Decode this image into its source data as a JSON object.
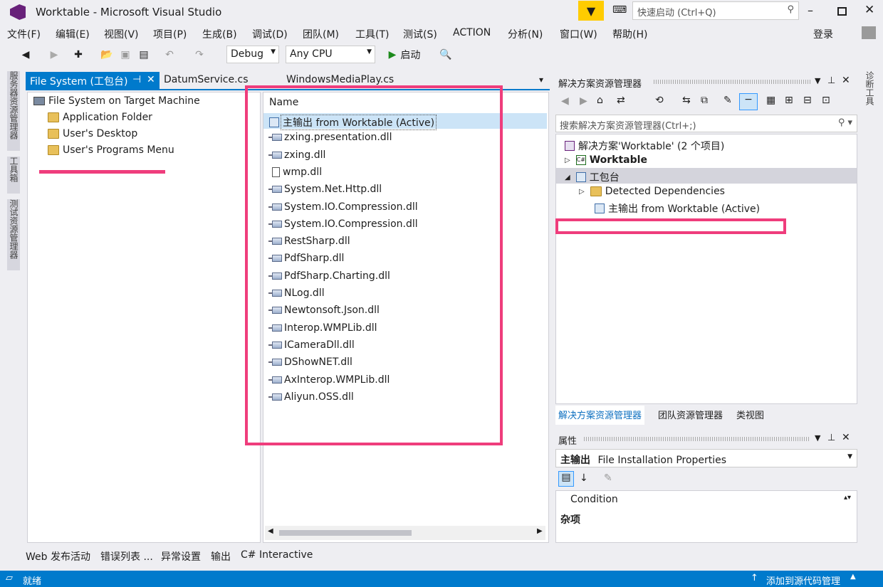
{
  "title": {
    "text": "Worktable - Microsoft Visual Studio",
    "quick_launch_placeholder": "快速启动 (Ctrl+Q)"
  },
  "menu": [
    "文件(F)",
    "编辑(E)",
    "视图(V)",
    "项目(P)",
    "生成(B)",
    "调试(D)",
    "团队(M)",
    "工具(T)",
    "测试(S)",
    "ACTION",
    "分析(N)",
    "窗口(W)",
    "帮助(H)"
  ],
  "login": "登录",
  "toolbar": {
    "config": "Debug",
    "platform": "Any CPU",
    "start": "启动"
  },
  "side_tabs": [
    "服务器资源管理器",
    "工具箱",
    "测试资源管理器"
  ],
  "right_side_tab": "诊断工具",
  "doc_tabs": {
    "active": "File System (工包台)",
    "tab2": "DatumService.cs",
    "tab3": "WindowsMediaPlay.cs"
  },
  "fs_tree": {
    "root": "File System on Target Machine",
    "children": [
      "Application Folder",
      "User's Desktop",
      "User's Programs Menu"
    ]
  },
  "files": {
    "header": "Name",
    "items": [
      "主输出 from Worktable (Active)",
      "zxing.presentation.dll",
      "zxing.dll",
      "wmp.dll",
      "System.Net.Http.dll",
      "System.IO.Compression.dll",
      "System.IO.Compression.dll",
      "RestSharp.dll",
      "PdfSharp.dll",
      "PdfSharp.Charting.dll",
      "NLog.dll",
      "Newtonsoft.Json.dll",
      "Interop.WMPLib.dll",
      "ICameraDll.dll",
      "DShowNET.dll",
      "AxInterop.WMPLib.dll",
      "Aliyun.OSS.dll"
    ]
  },
  "solution": {
    "title": "解决方案资源管理器",
    "search_placeholder": "搜索解决方案资源管理器(Ctrl+;)",
    "root": "解决方案'Worktable' (2 个项目)",
    "proj1": "Worktable",
    "proj2": "工包台",
    "dep": "Detected Dependencies",
    "output": "主输出 from Worktable (Active)"
  },
  "sol_tabs": [
    "解决方案资源管理器",
    "团队资源管理器",
    "类视图"
  ],
  "properties": {
    "title": "属性",
    "object": "主输出",
    "object_type": "File Installation Properties",
    "row1": "Condition",
    "category": "杂项"
  },
  "bottom_tabs": [
    "Web 发布活动",
    "错误列表 ...",
    "异常设置",
    "输出",
    "C# Interactive"
  ],
  "status": {
    "left": "就绪",
    "right": "添加到源代码管理"
  }
}
